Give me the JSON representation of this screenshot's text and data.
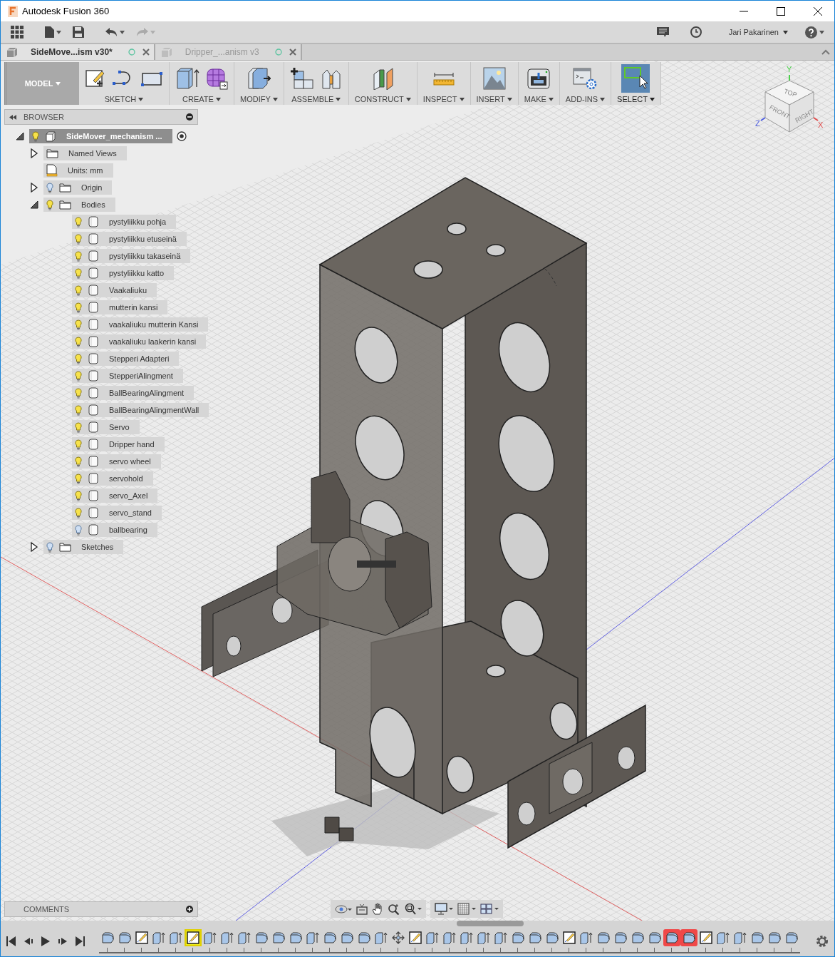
{
  "window": {
    "title": "Autodesk Fusion 360"
  },
  "toolbar": {
    "user": "Jari Pakarinen"
  },
  "tabs": [
    {
      "label": "SideMove...ism v30*",
      "selected": true
    },
    {
      "label": "Dripper_...anism v3",
      "selected": false
    }
  ],
  "ribbon": {
    "workspace": "MODEL",
    "groups": [
      {
        "label": "SKETCH",
        "tools": [
          {
            "kind": "sketch"
          },
          {
            "kind": "spline"
          },
          {
            "kind": "rectangle"
          }
        ],
        "selected": false
      },
      {
        "label": "CREATE",
        "tools": [
          {
            "kind": "extrude"
          },
          {
            "kind": "form"
          }
        ],
        "selected": false
      },
      {
        "label": "MODIFY",
        "tools": [
          {
            "kind": "pushpull"
          }
        ],
        "selected": false
      },
      {
        "label": "ASSEMBLE",
        "tools": [
          {
            "kind": "component"
          },
          {
            "kind": "joint"
          }
        ],
        "selected": false
      },
      {
        "label": "CONSTRUCT",
        "tools": [
          {
            "kind": "plane"
          }
        ],
        "selected": false
      },
      {
        "label": "INSPECT",
        "tools": [
          {
            "kind": "measure"
          }
        ],
        "selected": false
      },
      {
        "label": "INSERT",
        "tools": [
          {
            "kind": "image"
          }
        ],
        "selected": false
      },
      {
        "label": "MAKE",
        "tools": [
          {
            "kind": "printer"
          }
        ],
        "selected": false
      },
      {
        "label": "ADD-INS",
        "tools": [
          {
            "kind": "script"
          }
        ],
        "selected": false
      },
      {
        "label": "SELECT",
        "tools": [
          {
            "kind": "select"
          }
        ],
        "selected": true
      }
    ]
  },
  "browser": {
    "title": "BROWSER",
    "tree": [
      {
        "label": "SideMover_mechanism ...",
        "kind": "component",
        "expanded": true,
        "visible": true,
        "active": true,
        "children": [
          {
            "label": "Named Views",
            "kind": "folder",
            "expanded": false
          },
          {
            "label": "Units: mm",
            "kind": "units"
          },
          {
            "label": "Origin",
            "kind": "folder",
            "expanded": false,
            "visible": false
          },
          {
            "label": "Bodies",
            "kind": "folder",
            "expanded": true,
            "visible": true,
            "children": [
              {
                "label": "pystyliikku pohja",
                "kind": "body",
                "visible": true
              },
              {
                "label": "pystyliikku etuseinä",
                "kind": "body",
                "visible": true
              },
              {
                "label": "pystyliikku takaseinä",
                "kind": "body",
                "visible": true
              },
              {
                "label": "pystyliikku katto",
                "kind": "body",
                "visible": true
              },
              {
                "label": "Vaakaliuku",
                "kind": "body",
                "visible": true
              },
              {
                "label": "mutterin kansi",
                "kind": "body",
                "visible": true
              },
              {
                "label": "vaakaliuku mutterin Kansi",
                "kind": "body",
                "visible": true
              },
              {
                "label": "vaakaliuku laakerin kansi",
                "kind": "body",
                "visible": true
              },
              {
                "label": "Stepperi Adapteri",
                "kind": "body",
                "visible": true
              },
              {
                "label": "StepperiAlingment",
                "kind": "body",
                "visible": true
              },
              {
                "label": "BallBearingAlingment",
                "kind": "body",
                "visible": true
              },
              {
                "label": "BallBearingAlingmentWall",
                "kind": "body",
                "visible": true
              },
              {
                "label": "Servo",
                "kind": "body",
                "visible": true
              },
              {
                "label": "Dripper hand",
                "kind": "body",
                "visible": true
              },
              {
                "label": "servo wheel",
                "kind": "body",
                "visible": true
              },
              {
                "label": "servohold",
                "kind": "body",
                "visible": true
              },
              {
                "label": "servo_Axel",
                "kind": "body",
                "visible": true
              },
              {
                "label": "servo_stand",
                "kind": "body",
                "visible": true
              },
              {
                "label": "ballbearing",
                "kind": "body",
                "visible": false
              }
            ]
          },
          {
            "label": "Sketches",
            "kind": "folder",
            "expanded": false,
            "visible": false
          }
        ]
      }
    ]
  },
  "viewcube": {
    "faces": [
      "TOP",
      "FRONT",
      "RIGHT"
    ],
    "axes": [
      "Y",
      "Z",
      "X"
    ]
  },
  "comments": {
    "title": "COMMENTS"
  },
  "timeline": [
    {
      "kind": "fillet",
      "selected": false,
      "error": false
    },
    {
      "kind": "fillet",
      "selected": false,
      "error": false
    },
    {
      "kind": "sketch",
      "selected": false,
      "error": false
    },
    {
      "kind": "extrude",
      "selected": false,
      "error": false
    },
    {
      "kind": "extrude",
      "selected": false,
      "error": false
    },
    {
      "kind": "sketch",
      "selected": true,
      "error": false
    },
    {
      "kind": "extrude",
      "selected": false,
      "error": false
    },
    {
      "kind": "extrude",
      "selected": false,
      "error": false
    },
    {
      "kind": "extrude",
      "selected": false,
      "error": false
    },
    {
      "kind": "fillet",
      "selected": false,
      "error": false
    },
    {
      "kind": "fillet",
      "selected": false,
      "error": false
    },
    {
      "kind": "fillet",
      "selected": false,
      "error": false
    },
    {
      "kind": "extrude",
      "selected": false,
      "error": false
    },
    {
      "kind": "fillet",
      "selected": false,
      "error": false
    },
    {
      "kind": "fillet",
      "selected": false,
      "error": false
    },
    {
      "kind": "fillet",
      "selected": false,
      "error": false
    },
    {
      "kind": "extrude",
      "selected": false,
      "error": false
    },
    {
      "kind": "move",
      "selected": false,
      "error": false
    },
    {
      "kind": "sketch",
      "selected": false,
      "error": false
    },
    {
      "kind": "extrude",
      "selected": false,
      "error": false
    },
    {
      "kind": "extrude",
      "selected": false,
      "error": false
    },
    {
      "kind": "extrude",
      "selected": false,
      "error": false
    },
    {
      "kind": "extrude",
      "selected": false,
      "error": false
    },
    {
      "kind": "extrude",
      "selected": false,
      "error": false
    },
    {
      "kind": "fillet",
      "selected": false,
      "error": false
    },
    {
      "kind": "fillet",
      "selected": false,
      "error": false
    },
    {
      "kind": "fillet",
      "selected": false,
      "error": false
    },
    {
      "kind": "sketch",
      "selected": false,
      "error": false
    },
    {
      "kind": "extrude",
      "selected": false,
      "error": false
    },
    {
      "kind": "fillet",
      "selected": false,
      "error": false
    },
    {
      "kind": "fillet",
      "selected": false,
      "error": false
    },
    {
      "kind": "fillet",
      "selected": false,
      "error": false
    },
    {
      "kind": "fillet",
      "selected": false,
      "error": false
    },
    {
      "kind": "fillet",
      "selected": false,
      "error": true
    },
    {
      "kind": "fillet",
      "selected": false,
      "error": true
    },
    {
      "kind": "sketch",
      "selected": false,
      "error": false
    },
    {
      "kind": "extrude",
      "selected": false,
      "error": false
    },
    {
      "kind": "extrude",
      "selected": false,
      "error": false
    },
    {
      "kind": "fillet",
      "selected": false,
      "error": false
    },
    {
      "kind": "fillet",
      "selected": false,
      "error": false
    },
    {
      "kind": "fillet",
      "selected": false,
      "error": false
    }
  ]
}
